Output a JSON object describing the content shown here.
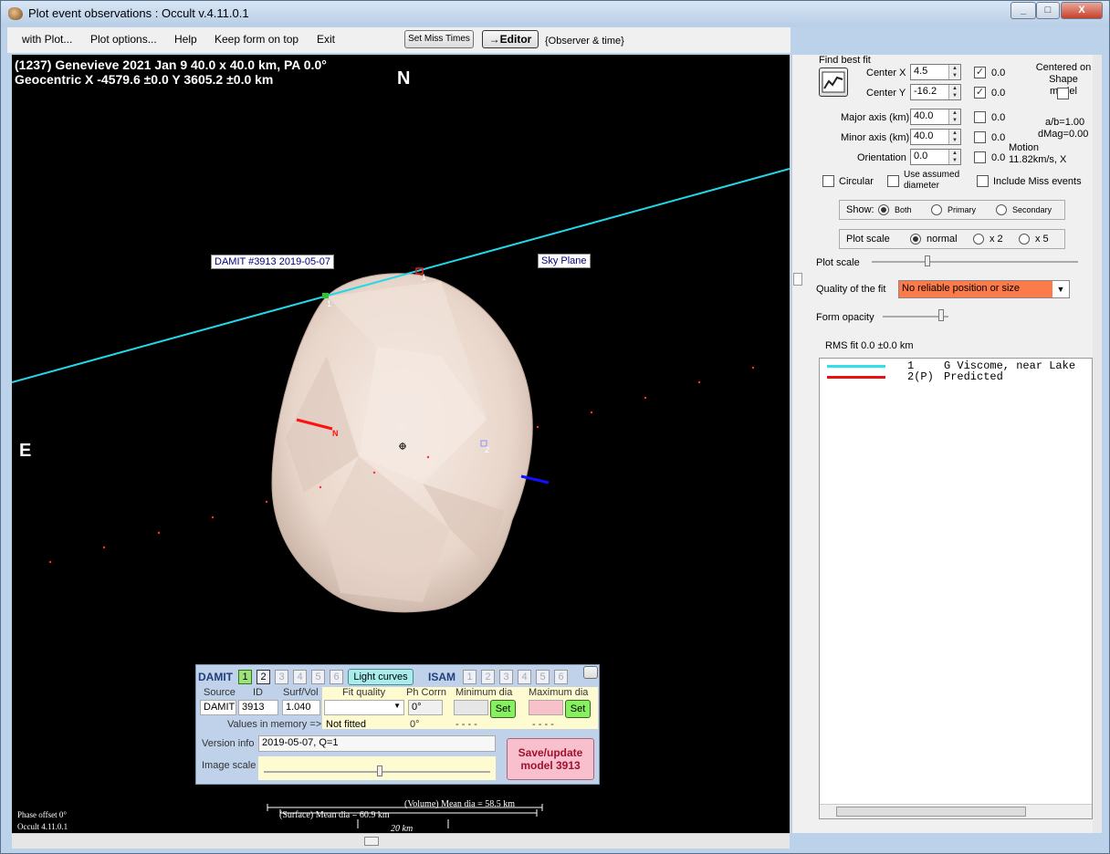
{
  "window": {
    "title": "Plot event observations : Occult v.4.11.0.1",
    "min": "_",
    "max": "□",
    "close": "X"
  },
  "menu": {
    "items": [
      "with Plot...",
      "Plot options...",
      "Help",
      "Keep form on top",
      "Exit"
    ],
    "set_miss_times": "Set Miss Times",
    "editor": "→Editor",
    "observer_time": "{Observer & time}"
  },
  "canvas": {
    "header_line1": "(1237) Genevieve  2021 Jan 9   40.0 x 40.0 km, PA 0.0°",
    "header_line2": "Geocentric  X  -4579.6 ±0.0  Y 3605.2 ±0.0 km",
    "north": "N",
    "east": "E",
    "damit_label": "DAMIT #3913 2019-05-07",
    "sky_plane": "Sky Plane",
    "chord_label_1": "1",
    "chord_label_2": "2",
    "pred_label": "1",
    "motion_n": "N",
    "phase_offset": "Phase offset 0°",
    "version": "Occult 4.11.0.1",
    "volume_mean": "(Volume) Mean dia = 58.5 km",
    "surface_mean": "(Surface) Mean dia = 60.9 km",
    "scale_bar": "20 km"
  },
  "fit": {
    "find_best_fit": "Find best fit",
    "center_x_label": "Center X",
    "center_x": "4.5",
    "center_x_delta": "0.0",
    "center_y_label": "Center Y",
    "center_y": "-16.2",
    "center_y_delta": "0.0",
    "major_label": "Major axis (km)",
    "major": "40.0",
    "major_delta": "0.0",
    "minor_label": "Minor axis (km)",
    "minor": "40.0",
    "minor_delta": "0.0",
    "orient_label": "Orientation",
    "orient": "0.0",
    "orient_delta": "0.0",
    "centered_label": "Centered on Shape model",
    "ab": "a/b=1.00",
    "dmag": "dMag=0.00",
    "motion": "Motion",
    "motion_val": "11.82km/s, X",
    "circular": "Circular",
    "use_assumed": "Use assumed diameter",
    "include_miss": "Include Miss events",
    "show_label": "Show:",
    "show_options": [
      "Both",
      "Primary",
      "Secondary"
    ],
    "plotscale_label": "Plot scale",
    "plotscale_options": [
      "normal",
      "x 2",
      "x 5"
    ],
    "plot_scale_slider": "Plot scale",
    "quality_label": "Quality of the fit",
    "quality_value": "No reliable position or size",
    "opacity_label": "Form opacity",
    "rms": "RMS fit 0.0 ±0.0 km",
    "legend": [
      {
        "num": "1     ",
        "text": "G Viscome, near Lake",
        "color": "#30e0e8"
      },
      {
        "num": "2(P)  ",
        "text": "Predicted",
        "color": "#e81010"
      }
    ]
  },
  "damit": {
    "title": "DAMIT",
    "tabs": [
      "1",
      "2",
      "3",
      "4",
      "5",
      "6"
    ],
    "light_curves": "Light curves",
    "isam": "ISAM",
    "isam_tabs": [
      "1",
      "2",
      "3",
      "4",
      "5",
      "6"
    ],
    "col_source": "Source",
    "col_id": "ID",
    "col_surf": "Surf/Vol",
    "source": "DAMIT",
    "id": "3913",
    "surf": "1.040",
    "values_in_memory": "Values in memory =>",
    "fit_quality": "Fit quality",
    "ph_corr": "Ph Corrn",
    "min_dia": "Minimum dia",
    "max_dia": "Maximum dia",
    "ph_value": "0°",
    "not_fitted": "Not fitted",
    "ph_mem": "0°",
    "dashes_min": "- - - -",
    "dashes_max": "- - - -",
    "set": "Set",
    "version_label": "Version info",
    "version_value": "2019-05-07, Q=1",
    "image_scale": "Image scale",
    "save": "Save/update model 3913"
  }
}
